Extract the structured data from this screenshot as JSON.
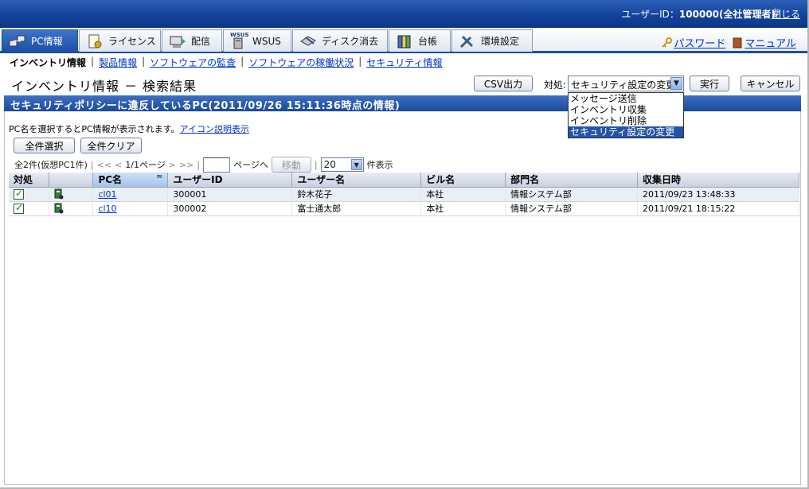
{
  "header": {
    "user_label": "ユーザーID：",
    "user_value": "100000(全社管理者)",
    "separator": "｜",
    "close_label": "閉じる"
  },
  "tabs": [
    {
      "label": "PC情報",
      "icon": "pc-network-icon",
      "active": true
    },
    {
      "label": "ライセンス",
      "icon": "license-document-icon",
      "active": false
    },
    {
      "label": "配信",
      "icon": "distribution-computer-icon",
      "active": false
    },
    {
      "label": "WSUS",
      "icon": "wsus-server-icon",
      "active": false,
      "badge": "WSUS"
    },
    {
      "label": "ディスク消去",
      "icon": "disk-erase-icon",
      "active": false
    },
    {
      "label": "台帳",
      "icon": "ledger-book-icon",
      "active": false
    },
    {
      "label": "環境設定",
      "icon": "tools-settings-icon",
      "active": false
    }
  ],
  "right_links": {
    "password_label": "パスワード",
    "password_icon": "key-icon",
    "manual_label": "マニュアル",
    "manual_icon": "book-icon"
  },
  "subnav": {
    "current": "インベントリ情報",
    "links": [
      "製品情報",
      "ソフトウェアの監査",
      "ソフトウェアの稼働状況",
      "セキュリティ情報"
    ],
    "separator": "|"
  },
  "page_title": "インベントリ情報 － 検索結果",
  "toolbar": {
    "csv_label": "CSV出力",
    "action_label": "対処:",
    "action_selected": "セキュリティ設定の変更",
    "action_options": [
      "メッセージ送信",
      "インベントリ収集",
      "インベントリ削除",
      "セキュリティ設定の変更"
    ],
    "execute_label": "実行",
    "cancel_label": "キャンセル"
  },
  "section_title": "セキュリティポリシーに違反しているPC(2011/09/26 15:11:36時点の情報)",
  "hint": {
    "text": "PC名を選択するとPC情報が表示されます。",
    "link": "アイコン説明表示"
  },
  "select_all_label": "全件選択",
  "clear_all_label": "全件クリア",
  "pager": {
    "summary": "全2件(仮想PC1件)",
    "first": "<<",
    "prev": "<",
    "page_text": "1/1ページ",
    "next": ">",
    "last": ">>",
    "bar": "|",
    "goto_suffix": "ページへ",
    "move_label": "移動",
    "per_page_value": "20",
    "per_page_suffix": "件表示"
  },
  "table": {
    "headers": [
      "対処",
      "",
      "PC名",
      "ユーザーID",
      "ユーザー名",
      "ビル名",
      "部門名",
      "収集日時"
    ],
    "sort_indicator": "≈",
    "rows": [
      {
        "checked": true,
        "pc": "cl01",
        "user_id": "300001",
        "user_name": "鈴木花子",
        "building": "本社",
        "dept": "情報システム部",
        "collected": "2011/09/23 13:48:33"
      },
      {
        "checked": true,
        "pc": "cl10",
        "user_id": "300002",
        "user_name": "富士通太郎",
        "building": "本社",
        "dept": "情報システム部",
        "collected": "2011/09/21 18:15:22"
      }
    ]
  },
  "colors": {
    "header_blue": "#12439a",
    "band_blue": "#1a4a9e",
    "link": "#0033cc"
  }
}
